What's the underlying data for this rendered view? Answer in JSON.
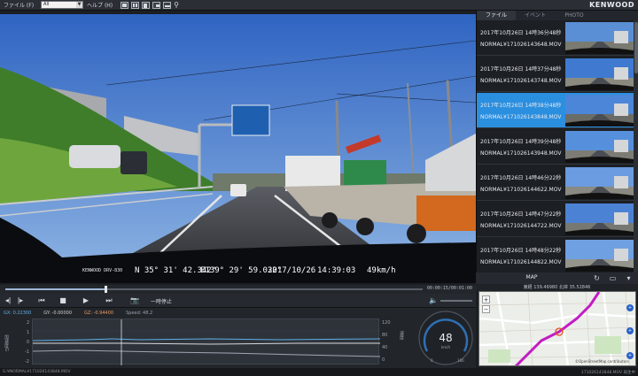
{
  "menu": {
    "file_label": "ファイル (F)",
    "file_select_value": "All",
    "help_label": "ヘルプ (H)"
  },
  "toolbar_icons": [
    "layout-single-icon",
    "layout-double-icon",
    "layout-video-icon",
    "layout-map-icon",
    "layout-split-icon",
    "zoom-icon"
  ],
  "brand": "KENWOOD",
  "video": {
    "osd_logo": "KENWOOD DRV-830",
    "latitude": "N  35° 31' 42.342\"",
    "longitude": "E139° 29' 59.032\"",
    "date": "2017/10/26",
    "time": "14:39:03",
    "speed": "49km/h"
  },
  "seek": {
    "progress": 0.24,
    "time": "00:00:15/00:01:00"
  },
  "controls": {
    "pause_label": "一時停止"
  },
  "gsensor": {
    "gx": "GX: 0.22300",
    "gy": "GY: -0.00000",
    "gz": "GZ: -0.94400",
    "speed": "Speed: 48.2",
    "y_left_ticks": [
      "2",
      "1",
      "0",
      "-1",
      "-2"
    ],
    "y_right_ticks": [
      "120",
      "80",
      "40",
      "0"
    ],
    "y_left_label": "加速度G",
    "y_right_label": "速度"
  },
  "speedometer": {
    "value": "48",
    "unit": "km/h",
    "ticks": [
      "0",
      "20",
      "40",
      "60",
      "80",
      "100",
      "120",
      "140",
      "160",
      "180"
    ]
  },
  "right_tabs": [
    "ファイル",
    "イベント",
    "PHOTO"
  ],
  "files": [
    {
      "date": "2017年10月26日 14時36分48秒",
      "name": "NORMAL¥171026143648.MOV"
    },
    {
      "date": "2017年10月26日 14時37分48秒",
      "name": "NORMAL¥171026143748.MOV"
    },
    {
      "date": "2017年10月26日 14時38分48秒",
      "name": "NORMAL¥171026143848.MOV"
    },
    {
      "date": "2017年10月26日 14時39分48秒",
      "name": "NORMAL¥171026143948.MOV"
    },
    {
      "date": "2017年10月26日 14時46分22秒",
      "name": "NORMAL¥171026144622.MOV"
    },
    {
      "date": "2017年10月26日 14時47分22秒",
      "name": "NORMAL¥171026144722.MOV"
    },
    {
      "date": "2017年10月26日 14時48分22秒",
      "name": "NORMAL¥171026144822.MOV"
    }
  ],
  "selected_file_index": 2,
  "map": {
    "label": "MAP",
    "coords": "東経 139.49980 北緯 35.52846",
    "attribution": "©OpenStreetMap contributors"
  },
  "status": {
    "left": "G:¥NORMAL¥171026143848.MOV",
    "right": "171026143848.MOV 再生中"
  },
  "colors": {
    "selection": "#2b8fe0",
    "route": "#c21cc4",
    "gx_line": "#5fb0e8",
    "gy_line": "#d8d8d8",
    "gz_line": "#9fa6ae"
  }
}
